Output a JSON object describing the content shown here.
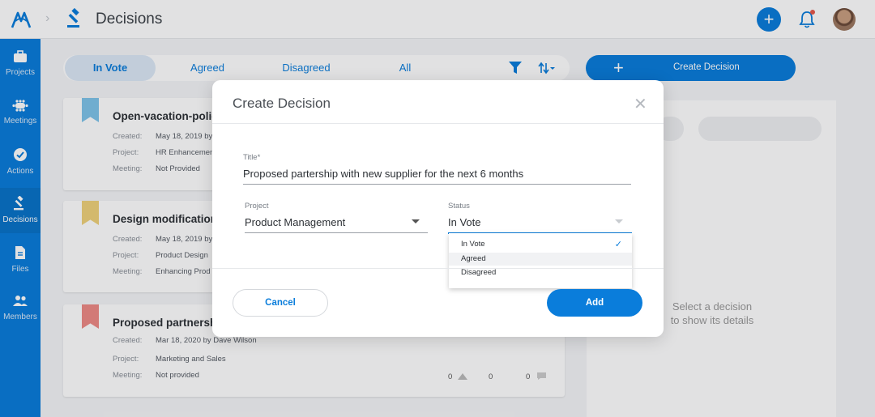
{
  "header": {
    "title": "Decisions",
    "add_icon": "plus-icon",
    "notification_icon": "bell-icon",
    "accent_color": "#0a7ddb",
    "notification_dot_color": "#e8584b"
  },
  "sidebar": {
    "items": [
      {
        "label": "Projects",
        "icon": "briefcase-icon"
      },
      {
        "label": "Meetings",
        "icon": "meeting-icon"
      },
      {
        "label": "Actions",
        "icon": "check-circle-icon"
      },
      {
        "label": "Decisions",
        "icon": "gavel-icon",
        "active": true
      },
      {
        "label": "Files",
        "icon": "file-icon"
      },
      {
        "label": "Members",
        "icon": "people-icon"
      }
    ]
  },
  "filters": {
    "tabs": [
      "In Vote",
      "Agreed",
      "Disagreed",
      "All"
    ],
    "active_tab": "In Vote"
  },
  "create_button": {
    "label": "Create Decision"
  },
  "decisions": [
    {
      "title": "Open-vacation-policy",
      "flag_color": "#7fc4ea",
      "created_label": "Created:",
      "created": "May 18, 2019 by",
      "project_label": "Project:",
      "project": "HR Enhancement",
      "meeting_label": "Meeting:",
      "meeting": "Not Provided"
    },
    {
      "title": "Design modifications",
      "flag_color": "#f0d27a",
      "created_label": "Created:",
      "created": "May 18, 2019 by",
      "project_label": "Project:",
      "project": "Product Design",
      "meeting_label": "Meeting:",
      "meeting": "Enhancing Prod"
    },
    {
      "title": "Proposed partnershi",
      "flag_color": "#ee8a86",
      "created_label": "Created:",
      "created": "Mar 18, 2020 by Dave Wilson",
      "project_label": "Project:",
      "project": "Marketing and Sales",
      "meeting_label": "Meeting:",
      "meeting": "Not provided",
      "votes_up": "0",
      "votes_down": "0",
      "comments": "0"
    }
  ],
  "detail_panel": {
    "empty_text": "Select a decision to show its details"
  },
  "modal": {
    "title": "Create Decision",
    "close_icon": "close-icon",
    "title_label": "Title*",
    "title_value": "Proposed partership with new supplier for the next 6 months",
    "project_label": "Project",
    "project_value": "Product Management",
    "status_label": "Status",
    "status_value": "In Vote",
    "status_options": [
      "In Vote",
      "Agreed",
      "Disagreed"
    ],
    "cancel_label": "Cancel",
    "add_label": "Add"
  }
}
